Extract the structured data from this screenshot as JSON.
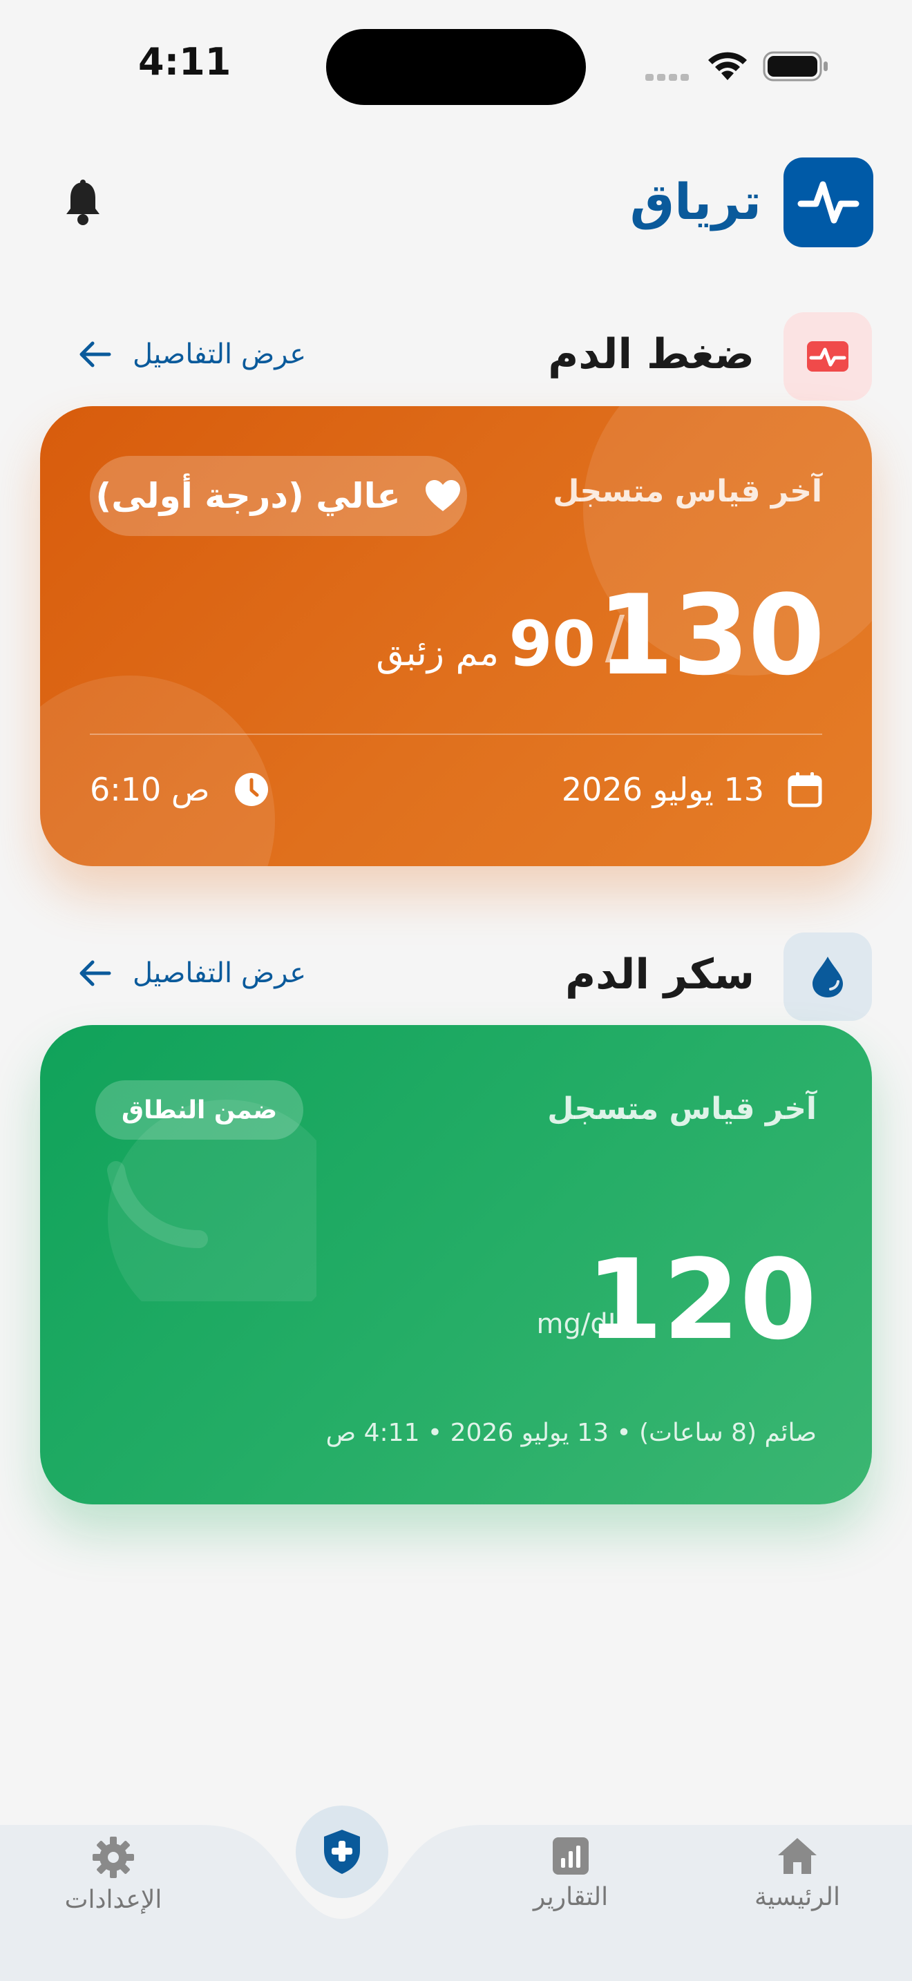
{
  "status_bar": {
    "time": "4:11"
  },
  "header": {
    "app_name": "ترياق"
  },
  "blood_pressure": {
    "title": "ضغط الدم",
    "details_link": "عرض التفاصيل",
    "card": {
      "label": "آخر قياس متسجل",
      "badge": "عالي (درجة أولى)",
      "systolic": "130",
      "separator": "/",
      "diastolic": "90",
      "unit": "مم زئبق",
      "date": "13 يوليو 2026",
      "time": "6:10 ص"
    },
    "accent_color": "#e0701d"
  },
  "blood_glucose": {
    "title": "سكر الدم",
    "details_link": "عرض التفاصيل",
    "card": {
      "label": "آخر قياس متسجل",
      "badge": "ضمن النطاق",
      "value": "120",
      "unit": "mg/dL",
      "meta": "صائم (8 ساعات) • 13 يوليو 2026 • 4:11 ص"
    },
    "accent_color": "#1ea963"
  },
  "bottom_nav": {
    "items": [
      {
        "label": "الرئيسية",
        "icon": "home-icon"
      },
      {
        "label": "التقارير",
        "icon": "reports-icon"
      },
      {
        "label": "",
        "icon": "medical-shield-icon"
      },
      {
        "label": "الإعدادات",
        "icon": "gear-icon"
      }
    ]
  }
}
